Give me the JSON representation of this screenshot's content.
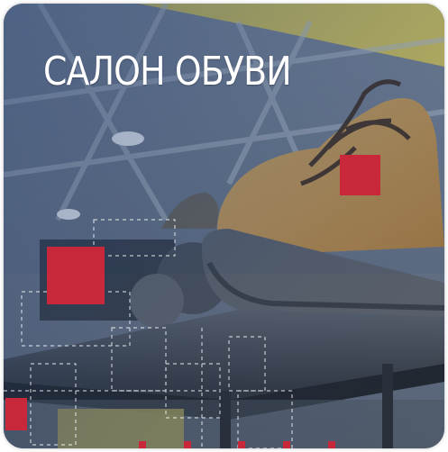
{
  "tile": {
    "title": "САЛОН ОБУВИ"
  },
  "colors": {
    "accent_red": "#c8283a",
    "overlay_blue": "#1e3a6e",
    "boot_tan": "#c99a4e",
    "sole_gray": "#5e636a",
    "shelf_gray": "#3f464f",
    "ceiling_yellow": "#e2cf55"
  },
  "icons": [
    "red-square-decor",
    "dashed-grid-decor"
  ]
}
